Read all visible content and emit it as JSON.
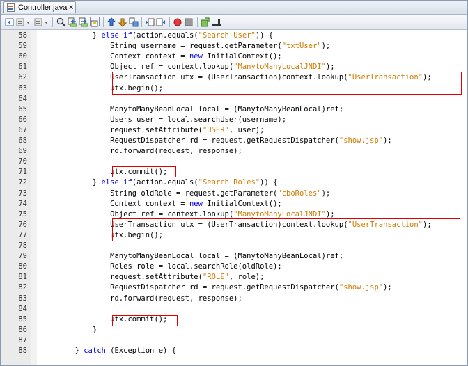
{
  "tab": {
    "title": "Controller.java",
    "close": "×"
  },
  "toolbar": {
    "buttons": [
      "back-icon",
      "history-icon",
      "forward-icon",
      "find-icon",
      "find-prev-icon",
      "find-next-icon",
      "toggle-highlight-icon",
      "prev-bookmark-icon",
      "next-bookmark-icon",
      "toggle-bookmark-icon",
      "shift-left-icon",
      "shift-right-icon",
      "record-macro-icon",
      "stop-macro-icon",
      "diff-icon",
      "comment-icon"
    ]
  },
  "lines": [
    {
      "n": "58",
      "indent": "            ",
      "parts": [
        {
          "t": "} "
        },
        {
          "t": "else",
          "k": "kw"
        },
        {
          "t": " "
        },
        {
          "t": "if",
          "k": "kw"
        },
        {
          "t": "(action.equals("
        },
        {
          "t": "\"Search User\"",
          "k": "str"
        },
        {
          "t": ")) {"
        }
      ]
    },
    {
      "n": "59",
      "indent": "                ",
      "parts": [
        {
          "t": "String username = request.getParameter("
        },
        {
          "t": "\"txtUser\"",
          "k": "str"
        },
        {
          "t": ");"
        }
      ]
    },
    {
      "n": "60",
      "indent": "                ",
      "parts": [
        {
          "t": "Context context = "
        },
        {
          "t": "new",
          "k": "kw"
        },
        {
          "t": " InitialContext();"
        }
      ]
    },
    {
      "n": "61",
      "indent": "                ",
      "parts": [
        {
          "t": "Object ref = context.lookup("
        },
        {
          "t": "\"ManytoManyLocalJNDI\"",
          "k": "str"
        },
        {
          "t": ");"
        }
      ]
    },
    {
      "n": "62",
      "indent": "                ",
      "parts": [
        {
          "t": "UserTransaction utx = (UserTransaction)context.lookup("
        },
        {
          "t": "\"UserTransaction\"",
          "k": "str"
        },
        {
          "t": ");"
        }
      ]
    },
    {
      "n": "63",
      "indent": "                ",
      "parts": [
        {
          "t": "utx.begin();"
        }
      ]
    },
    {
      "n": "64",
      "indent": "",
      "parts": []
    },
    {
      "n": "65",
      "indent": "                ",
      "parts": [
        {
          "t": "ManytoManyBeanLocal local = (ManytoManyBeanLocal)ref;"
        }
      ]
    },
    {
      "n": "66",
      "indent": "                ",
      "parts": [
        {
          "t": "Users user = local.searchUser(username);"
        }
      ]
    },
    {
      "n": "67",
      "indent": "                ",
      "parts": [
        {
          "t": "request.setAttribute("
        },
        {
          "t": "\"USER\"",
          "k": "str"
        },
        {
          "t": ", user);"
        }
      ]
    },
    {
      "n": "68",
      "indent": "                ",
      "parts": [
        {
          "t": "RequestDispatcher rd = request.getRequestDispatcher("
        },
        {
          "t": "\"show.jsp\"",
          "k": "str"
        },
        {
          "t": ");"
        }
      ]
    },
    {
      "n": "69",
      "indent": "                ",
      "parts": [
        {
          "t": "rd.forward(request, response);"
        }
      ]
    },
    {
      "n": "70",
      "indent": "",
      "parts": []
    },
    {
      "n": "71",
      "indent": "                ",
      "parts": [
        {
          "t": "utx.commit();"
        }
      ]
    },
    {
      "n": "72",
      "indent": "            ",
      "parts": [
        {
          "t": "} "
        },
        {
          "t": "else",
          "k": "kw"
        },
        {
          "t": " "
        },
        {
          "t": "if",
          "k": "kw"
        },
        {
          "t": "(action.equals("
        },
        {
          "t": "\"Search Roles\"",
          "k": "str"
        },
        {
          "t": ")) {"
        }
      ]
    },
    {
      "n": "73",
      "indent": "                ",
      "parts": [
        {
          "t": "String oldRole = request.getParameter("
        },
        {
          "t": "\"cboRoles\"",
          "k": "str"
        },
        {
          "t": ");"
        }
      ]
    },
    {
      "n": "74",
      "indent": "                ",
      "parts": [
        {
          "t": "Context context = "
        },
        {
          "t": "new",
          "k": "kw"
        },
        {
          "t": " InitialContext();"
        }
      ]
    },
    {
      "n": "75",
      "indent": "                ",
      "parts": [
        {
          "t": "Object ref = context.lookup("
        },
        {
          "t": "\"ManytoManyLocalJNDI\"",
          "k": "str"
        },
        {
          "t": ");"
        }
      ]
    },
    {
      "n": "76",
      "indent": "                ",
      "parts": [
        {
          "t": "UserTransaction utx = (UserTransaction)context.lookup("
        },
        {
          "t": "\"UserTransaction\"",
          "k": "str"
        },
        {
          "t": ");"
        }
      ]
    },
    {
      "n": "77",
      "indent": "                ",
      "parts": [
        {
          "t": "utx.begin();"
        }
      ]
    },
    {
      "n": "78",
      "indent": "",
      "parts": []
    },
    {
      "n": "79",
      "indent": "                ",
      "parts": [
        {
          "t": "ManytoManyBeanLocal local = (ManytoManyBeanLocal)ref;"
        }
      ]
    },
    {
      "n": "80",
      "indent": "                ",
      "parts": [
        {
          "t": "Roles role = local.searchRole(oldRole);"
        }
      ]
    },
    {
      "n": "81",
      "indent": "                ",
      "parts": [
        {
          "t": "request.setAttribute("
        },
        {
          "t": "\"ROLE\"",
          "k": "str"
        },
        {
          "t": ", role);"
        }
      ]
    },
    {
      "n": "82",
      "indent": "                ",
      "parts": [
        {
          "t": "RequestDispatcher rd = request.getRequestDispatcher("
        },
        {
          "t": "\"show.jsp\"",
          "k": "str"
        },
        {
          "t": ");"
        }
      ]
    },
    {
      "n": "83",
      "indent": "                ",
      "parts": [
        {
          "t": "rd.forward(request, response);"
        }
      ]
    },
    {
      "n": "84",
      "indent": "",
      "parts": []
    },
    {
      "n": "85",
      "indent": "                ",
      "parts": [
        {
          "t": "utx.commit();"
        }
      ]
    },
    {
      "n": "86",
      "indent": "            ",
      "parts": [
        {
          "t": "}"
        }
      ]
    },
    {
      "n": "87",
      "indent": "",
      "parts": []
    },
    {
      "n": "88",
      "indent": "        ",
      "parts": [
        {
          "t": "} "
        },
        {
          "t": "catch",
          "k": "kw"
        },
        {
          "t": " (Exception e) {"
        }
      ]
    }
  ],
  "colors": {
    "keyword": "#0000e6",
    "string": "#ce7b00",
    "highlight_box": "#e00000",
    "margin_line": "#f2a0a0"
  }
}
